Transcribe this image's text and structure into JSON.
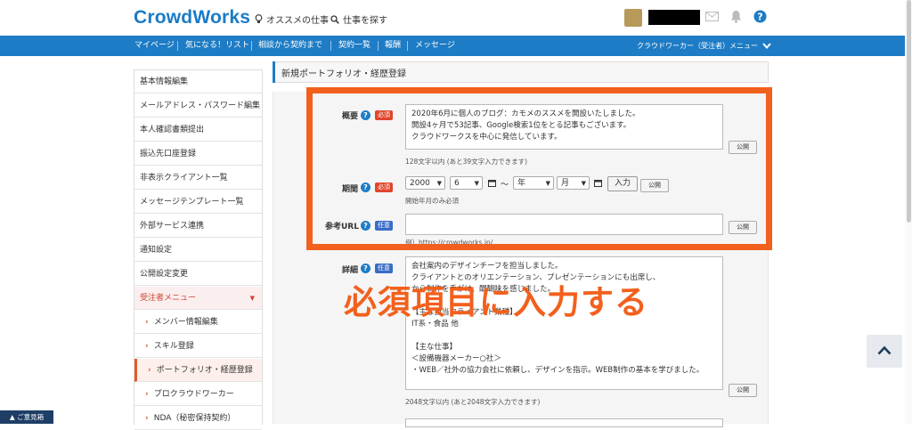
{
  "header": {
    "logo": "CrowdWorks",
    "recommend_jobs": "オススメの仕事",
    "search_jobs": "仕事を探す"
  },
  "nav": {
    "items": [
      "マイページ",
      "気になる！リスト",
      "相談から契約まで",
      "契約一覧",
      "報酬",
      "メッセージ"
    ],
    "menu": "クラウドワーカー（受注者）メニュー"
  },
  "sidebar": {
    "items": [
      "基本情報編集",
      "メールアドレス・パスワード編集",
      "本人確認書類提出",
      "振込先口座登録",
      "非表示クライアント一覧",
      "メッセージテンプレート一覧",
      "外部サービス連携",
      "通知設定",
      "公開設定変更"
    ],
    "section_head": "受注者メニュー",
    "sub_items": [
      "メンバー情報編集",
      "スキル登録",
      "ポートフォリオ・経歴登録",
      "プロクラウドワーカー",
      "NDA（秘密保持契約）"
    ]
  },
  "main": {
    "title": "新規ポートフォリオ・経歴登録",
    "summary": {
      "label": "概要",
      "badge": "必須",
      "value": "2020年6月に個人のブログ：カモメのススメを開設いたしました。\n開設4ヶ月で53記事、Google検索1位をとる記事もございます。\nクラウドワークスを中心に発信しています。",
      "note": "128文字以内 (あと39文字入力できます)",
      "public": "公開"
    },
    "period": {
      "label": "期間",
      "badge": "必須",
      "year": "2000",
      "month": "6",
      "tilde": "〜",
      "end_year": "年",
      "end_month": "月",
      "input_btn": "入力",
      "public": "公開",
      "note": "開始年月のみ必須"
    },
    "ref_url": {
      "label": "参考URL",
      "badge": "任意",
      "placeholder": "例）https://crowdworks.jp/",
      "public": "公開"
    },
    "detail": {
      "label": "詳細",
      "badge": "任意",
      "value": "会社案内のデザインチーフを担当しました。\nクライアントとのオリエンテーション、プレゼンテーションにも出席し、\nから制作を手がけ、醍醐味を感じました。\n\n【主な担当クライアント業種】\nIT系・食品 他\n\n【主な仕事】\n＜設備機器メーカー○社＞\n・WEB／社外の協力会社に依頼し、デザインを指示。WEB制作の基本を学びました。",
      "note": "2048文字以内 (あと2048文字入力できます)",
      "public": "公開"
    }
  },
  "overlay": {
    "text": "必須項目に入力する"
  },
  "feedback": "▲ ご意見箱",
  "colors": {
    "brand_blue": "#1d7cc5",
    "highlight_orange": "#f2601d",
    "required_red": "#e0452b",
    "optional_blue": "#3a6cc7"
  }
}
